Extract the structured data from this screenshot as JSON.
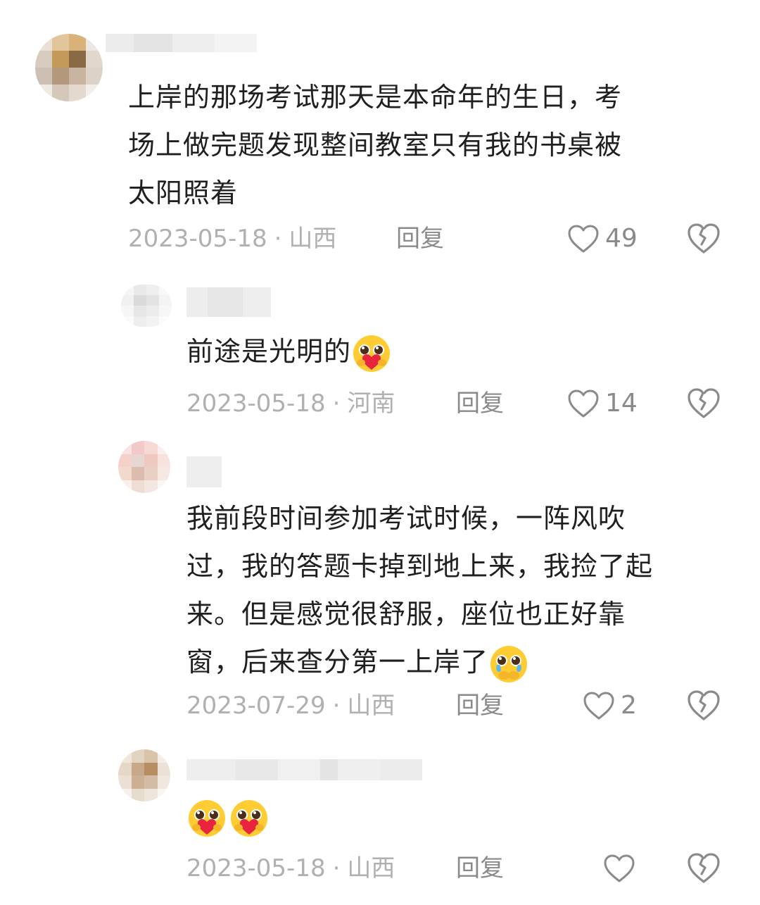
{
  "comments": [
    {
      "text_lines": [
        "上岸的那场考试那天是本命年的生日，考",
        "场上做完题发现整间教室只有我的书桌被",
        "太阳照着"
      ],
      "date": "2023-05-18",
      "dot": "·",
      "location": "山西",
      "reply_label": "回复",
      "likes": "49"
    },
    {
      "text_lines": [
        "前途是光明的"
      ],
      "emoji": "pleading-heart-emoji",
      "date": "2023-05-18",
      "dot": "·",
      "location": "河南",
      "reply_label": "回复",
      "likes": "14"
    },
    {
      "text_lines": [
        "我前段时间参加考试时候，一阵风吹",
        "过，我的答题卡掉到地上来，我捡了起",
        "来。但是感觉很舒服，座位也正好靠",
        "窗，后来查分第一上岸了"
      ],
      "emoji": "holding-back-tears-emoji",
      "date": "2023-07-29",
      "dot": "·",
      "location": "山西",
      "reply_label": "回复",
      "likes": "2"
    },
    {
      "emojis": [
        "pleading-heart-emoji",
        "pleading-heart-emoji"
      ],
      "date": "2023-05-18",
      "dot": "·",
      "location": "山西",
      "reply_label": "回复",
      "likes": ""
    }
  ],
  "colors": {
    "text": "#1f1f1f",
    "meta": "#b0b0b0",
    "icon": "#8a8a8a"
  }
}
